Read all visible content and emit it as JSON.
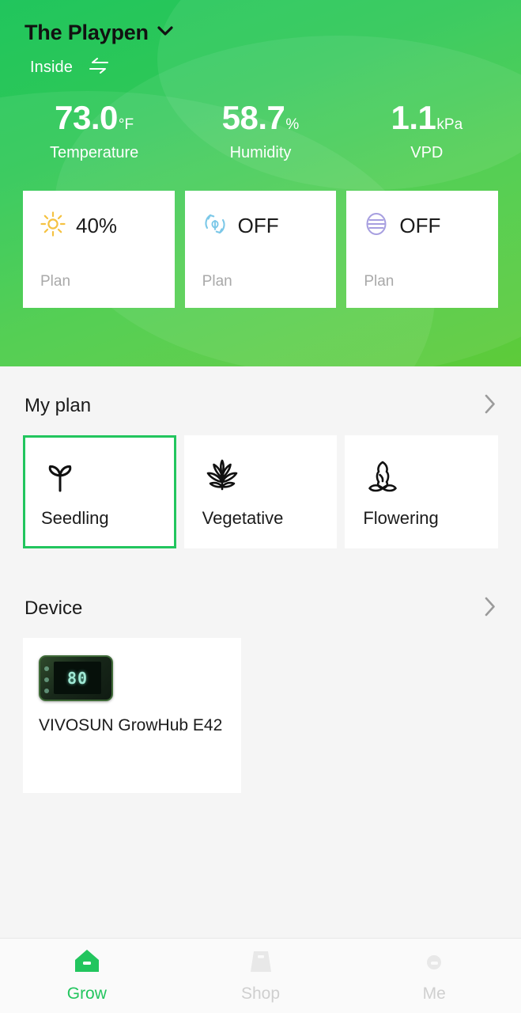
{
  "header": {
    "title": "The Playpen",
    "title_chevron_icon": "chevron-down-icon",
    "location": "Inside",
    "swap_icon": "swap-arrows-icon",
    "stats": [
      {
        "value": "73.0",
        "unit": "°F",
        "label": "Temperature"
      },
      {
        "value": "58.7",
        "unit": "%",
        "label": "Humidity"
      },
      {
        "value": "1.1",
        "unit": "kPa",
        "label": "VPD"
      }
    ],
    "controls": [
      {
        "icon": "sun-icon",
        "value": "40%",
        "mode": "Plan",
        "color": "#f5c242"
      },
      {
        "icon": "fan-recirculate-leaf-icon",
        "value": "OFF",
        "mode": "Plan",
        "color": "#7cc8e8"
      },
      {
        "icon": "humidity-lines-circle-icon",
        "value": "OFF",
        "mode": "Plan",
        "color": "#a79fe0"
      }
    ]
  },
  "plan_section": {
    "title": "My plan",
    "chevron_icon": "chevron-right-icon",
    "items": [
      {
        "label": "Seedling",
        "icon": "sprout-icon",
        "selected": true
      },
      {
        "label": "Vegetative",
        "icon": "cannabis-leaf-icon",
        "selected": false
      },
      {
        "label": "Flowering",
        "icon": "flower-bud-icon",
        "selected": false
      }
    ]
  },
  "device_section": {
    "title": "Device",
    "chevron_icon": "chevron-right-icon",
    "devices": [
      {
        "name": "VIVOSUN GrowHub E42",
        "thumb_icon": "growhub-controller-image",
        "display_value": "80"
      }
    ]
  },
  "bottom_nav": {
    "items": [
      {
        "label": "Grow",
        "icon": "home-icon",
        "active": true
      },
      {
        "label": "Shop",
        "icon": "bag-icon",
        "active": false
      },
      {
        "label": "Me",
        "icon": "person-icon",
        "active": false
      }
    ]
  },
  "colors": {
    "brand_green": "#22c55e",
    "header_gradient_start": "#21c55d",
    "header_gradient_end": "#5ecb3a",
    "page_background": "#f5f5f5",
    "card_background": "#ffffff",
    "muted_text": "#a9a9a9",
    "nav_inactive": "#cfcfcf"
  }
}
